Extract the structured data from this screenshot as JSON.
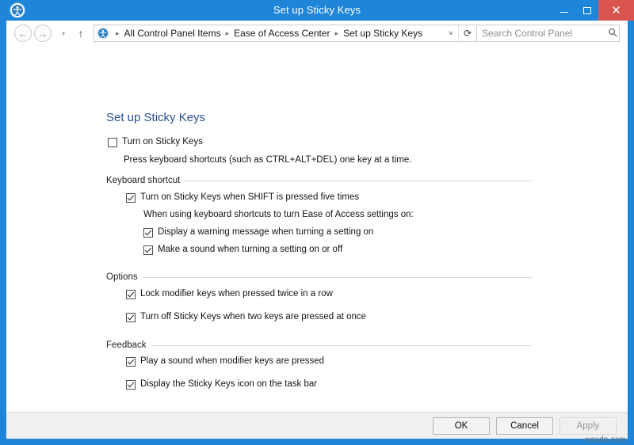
{
  "window": {
    "title": "Set up Sticky Keys",
    "icon": "ease-of-access-icon",
    "accent_color": "#1e85d8",
    "close_color": "#d9534f",
    "controls": {
      "minimize": "–",
      "maximize": "□",
      "close": "✕"
    }
  },
  "nav": {
    "back": "←",
    "forward": "→",
    "recent": "▾",
    "up": "↑",
    "dropdown": "˅",
    "refresh": "⟳",
    "breadcrumbs": [
      "All Control Panel Items",
      "Ease of Access Center",
      "Set up Sticky Keys"
    ],
    "separator": "▸"
  },
  "search": {
    "placeholder": "Search Control Panel",
    "value": "",
    "icon": "search-icon"
  },
  "page": {
    "heading": "Set up Sticky Keys",
    "main_checkbox": {
      "label": "Turn on Sticky Keys",
      "checked": false
    },
    "main_description": "Press keyboard shortcuts (such as CTRL+ALT+DEL) one key at a time.",
    "sections": [
      {
        "title": "Keyboard shortcut",
        "items": [
          {
            "type": "checkbox",
            "label": "Turn on Sticky Keys when SHIFT is pressed five times",
            "checked": true
          },
          {
            "type": "text",
            "label": "When using keyboard shortcuts to turn Ease of Access settings on:"
          },
          {
            "type": "checkbox",
            "label": "Display a warning message when turning a setting on",
            "checked": true
          },
          {
            "type": "checkbox",
            "label": "Make a sound when turning a setting on or off",
            "checked": true
          }
        ]
      },
      {
        "title": "Options",
        "items": [
          {
            "type": "checkbox",
            "label": "Lock modifier keys when pressed twice in a row",
            "checked": true
          },
          {
            "type": "checkbox",
            "label": "Turn off Sticky Keys when two keys are pressed at once",
            "checked": true
          }
        ]
      },
      {
        "title": "Feedback",
        "items": [
          {
            "type": "checkbox",
            "label": "Play a sound when modifier keys are pressed",
            "checked": true
          },
          {
            "type": "checkbox",
            "label": "Display the Sticky Keys icon on the task bar",
            "checked": true
          }
        ]
      }
    ]
  },
  "footer": {
    "ok": "OK",
    "cancel": "Cancel",
    "apply": "Apply",
    "apply_enabled": false
  },
  "watermark": "wsxdn.com"
}
